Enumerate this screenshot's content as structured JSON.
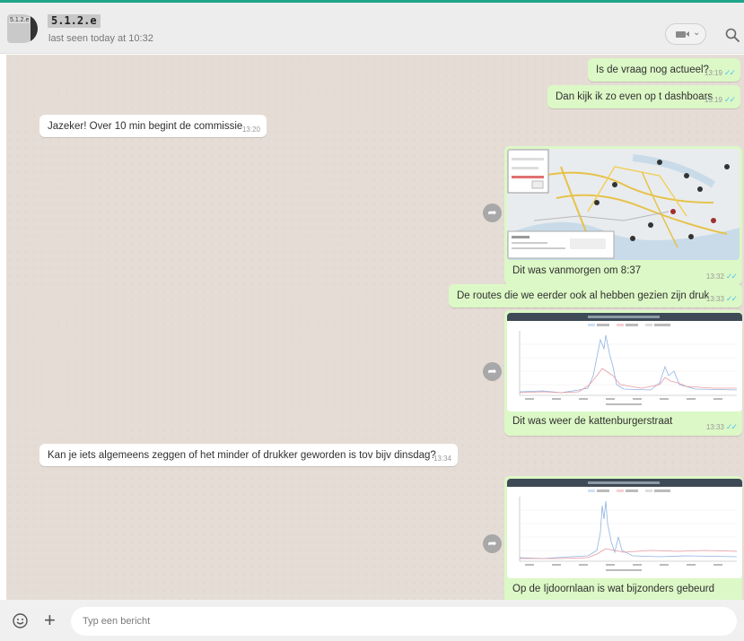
{
  "header": {
    "avatar_label": "5.1.2.e",
    "contact_name": "5.1.2.e",
    "status": "last seen today at 10:32",
    "video_icon": "video-camera-icon",
    "search_icon": "search-icon"
  },
  "messages": [
    {
      "dir": "out",
      "text": "Is de vraag nog actueel?",
      "time": "13:19"
    },
    {
      "dir": "out",
      "text": "Dan kijk ik zo even op t dashboars",
      "time": "13:19"
    },
    {
      "dir": "in",
      "text": "Jazeker! Over 10 min begint de commissie",
      "time": "13:20"
    },
    {
      "dir": "out",
      "text": "Dit was vanmorgen om 8:37",
      "time": "13:32",
      "image": "map"
    },
    {
      "dir": "out",
      "text": "De routes die we eerder ook al hebben gezien zijn druk",
      "time": "13:33"
    },
    {
      "dir": "out",
      "text": "Dit was weer de kattenburgerstraat",
      "time": "13:33",
      "image": "chart"
    },
    {
      "dir": "in",
      "text": "Kan je iets algemeens zeggen of het minder of drukker geworden is tov bijv dinsdag?",
      "time": "13:34"
    },
    {
      "dir": "out",
      "text": "Op de Ijdoornlaan is wat bijzonders gebeurd",
      "time": "",
      "image": "chart"
    }
  ],
  "footer": {
    "placeholder": "Typ een bericht",
    "emoji_icon": "emoji-icon",
    "attach_icon": "plus-icon"
  },
  "colors": {
    "accent": "#1fa58a",
    "outgoing_bubble": "#dcf8c6",
    "incoming_bubble": "#ffffff",
    "chat_background": "#e5ddd5",
    "read_tick": "#4fc3f7"
  }
}
